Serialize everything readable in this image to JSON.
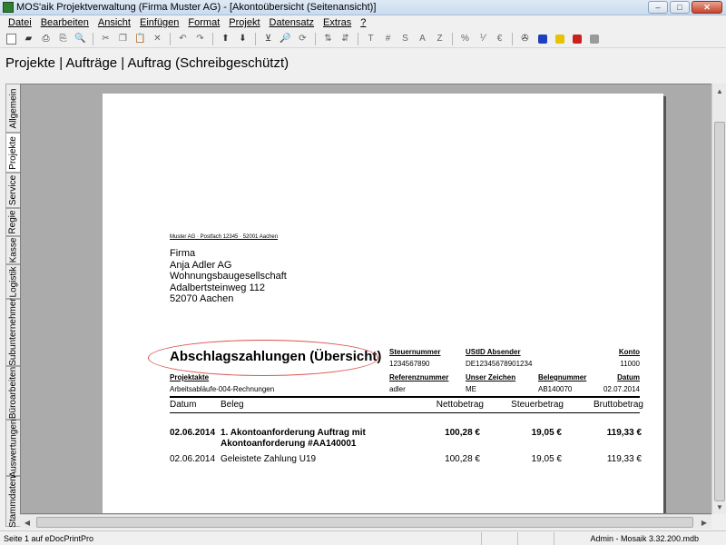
{
  "window": {
    "title": "MOS'aik Projektverwaltung (Firma Muster AG) - [Akontoübersicht (Seitenansicht)]",
    "minimize": "–",
    "maximize": "□",
    "close": "✕"
  },
  "menu": {
    "items": [
      "Datei",
      "Bearbeiten",
      "Ansicht",
      "Einfügen",
      "Format",
      "Projekt",
      "Datensatz",
      "Extras",
      "?"
    ]
  },
  "toolbar": {
    "text_buttons": {
      "t": "T",
      "hash": "#",
      "s": "S",
      "a": "A",
      "z": "Z",
      "percent": "%"
    }
  },
  "header": {
    "breadcrumb": "Projekte | Aufträge | Auftrag (Schreibgeschützt)"
  },
  "sidetabs": [
    "Allgemein",
    "Projekte",
    "Service",
    "Regie",
    "Kasse",
    "Logistik",
    "Subunternehmer",
    "Büroarbeiten",
    "Auswertungen",
    "Stammdaten"
  ],
  "document": {
    "sender_line": "Muster AG · Postfach 12345 · 52001 Aachen",
    "address": [
      "Firma",
      "Anja Adler AG",
      "Wohnungsbaugesellschaft",
      "Adalbertsteinweg 112",
      "52070 Aachen"
    ],
    "title": "Abschlagszahlungen (Übersicht)",
    "meta": {
      "steuernummer_label": "Steuernummer",
      "steuernummer": "1234567890",
      "ustid_label": "UStID Absender",
      "ustid": "DE12345678901234",
      "konto_label": "Konto",
      "konto": "11000",
      "projektakte_label": "Projektakte",
      "projektakte": "Arbeitsabläufe-004-Rechnungen",
      "referenz_label": "Referenznummer",
      "referenz": "adler",
      "zeichen_label": "Unser Zeichen",
      "zeichen": "ME",
      "beleg_label": "Belegnummer",
      "beleg": "AB140070",
      "datum_label": "Datum",
      "datum": "02.07.2014"
    },
    "table": {
      "headers": {
        "datum": "Datum",
        "beleg": "Beleg",
        "netto": "Nettobetrag",
        "steuer": "Steuerbetrag",
        "brutto": "Bruttobetrag"
      },
      "rows": [
        {
          "datum": "02.06.2014",
          "beleg_line1": "1. Akontoanforderung Auftrag mit",
          "beleg_line2": "Akontoanforderung #AA140001",
          "netto": "100,28 €",
          "steuer": "19,05 €",
          "brutto": "119,33 €"
        },
        {
          "datum": "02.06.2014",
          "beleg_line1": "Geleistete Zahlung U19",
          "netto": "100,28 €",
          "steuer": "19,05 €",
          "brutto": "119,33 €"
        }
      ]
    }
  },
  "statusbar": {
    "left": "Seite 1 auf eDocPrintPro",
    "right": "Admin - Mosaik 3.32.200.mdb"
  },
  "colors": {
    "ellipse": "#d9534f",
    "preview_bg": "#ababab"
  }
}
